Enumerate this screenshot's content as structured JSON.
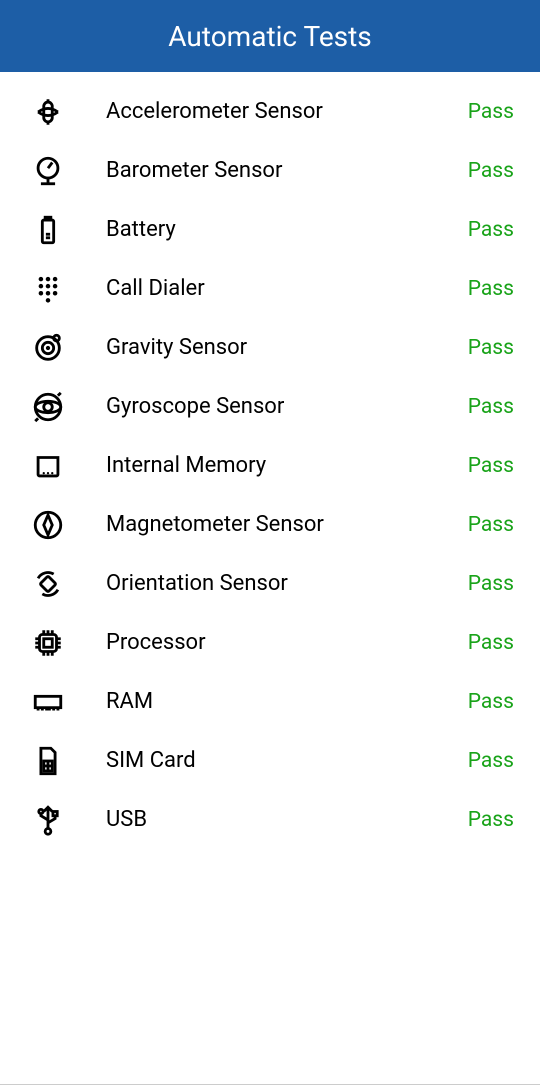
{
  "header": {
    "title": "Automatic Tests"
  },
  "tests": [
    {
      "icon": "accelerometer",
      "label": "Accelerometer Sensor",
      "status": "Pass"
    },
    {
      "icon": "barometer",
      "label": "Barometer Sensor",
      "status": "Pass"
    },
    {
      "icon": "battery",
      "label": "Battery",
      "status": "Pass"
    },
    {
      "icon": "dialer",
      "label": "Call Dialer",
      "status": "Pass"
    },
    {
      "icon": "gravity",
      "label": "Gravity Sensor",
      "status": "Pass"
    },
    {
      "icon": "gyroscope",
      "label": "Gyroscope Sensor",
      "status": "Pass"
    },
    {
      "icon": "memory",
      "label": "Internal Memory",
      "status": "Pass"
    },
    {
      "icon": "magnetometer",
      "label": "Magnetometer Sensor",
      "status": "Pass"
    },
    {
      "icon": "orientation",
      "label": "Orientation Sensor",
      "status": "Pass"
    },
    {
      "icon": "processor",
      "label": "Processor",
      "status": "Pass"
    },
    {
      "icon": "ram",
      "label": "RAM",
      "status": "Pass"
    },
    {
      "icon": "sim",
      "label": "SIM Card",
      "status": "Pass"
    },
    {
      "icon": "usb",
      "label": "USB",
      "status": "Pass"
    }
  ]
}
